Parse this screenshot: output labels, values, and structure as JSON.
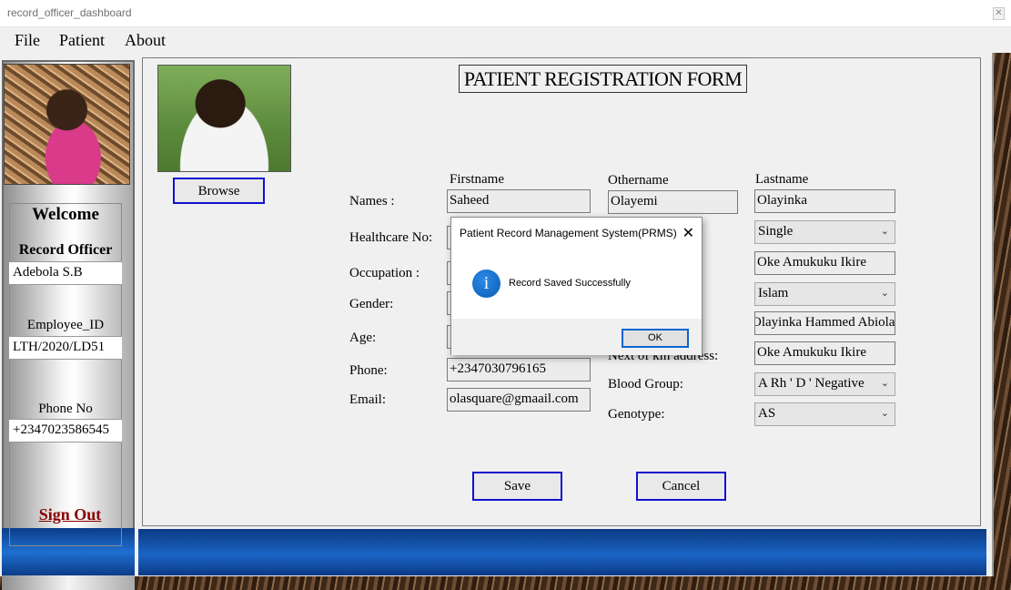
{
  "window": {
    "title": "record_officer_dashboard",
    "close_glyph": "✕"
  },
  "menu": [
    "File",
    "Patient",
    "About"
  ],
  "sidebar": {
    "welcome": "Welcome",
    "role": "Record Officer",
    "name": "Adebola S.B",
    "employee_id_label": "Employee_ID",
    "employee_id": "LTH/2020/LD51",
    "phone_label": "Phone No",
    "phone": "+2347023586545",
    "sign_out": "Sign Out"
  },
  "form": {
    "title": "PATIENT REGISTRATION FORM",
    "browse": "Browse",
    "columns": {
      "firstname": "Firstname",
      "othername": "Othername",
      "lastname": "Lastname"
    },
    "labels": {
      "names": "Names :",
      "healthcare_no": "Healthcare No:",
      "occupation": "Occupation :",
      "gender": "Gender:",
      "age": "Age:",
      "phone": "Phone:",
      "email": "Email:",
      "next_of_kin_address": "Next of kin address:",
      "blood_group": "Blood Group:",
      "genotype": "Genotype:"
    },
    "values": {
      "firstname": "Saheed",
      "othername": "Olayemi",
      "lastname": "Olayinka",
      "phone": "+2347030796165",
      "email": "olasquare@gmaail.com",
      "marital_status": "Single",
      "address": "Oke Amukuku Ikire",
      "religion": "Islam",
      "next_of_kin": "Olayinka Hammed Abiola",
      "next_of_kin_address": "Oke Amukuku Ikire",
      "blood_group": "A Rh ' D ' Negative",
      "genotype": "AS"
    },
    "save": "Save",
    "cancel": "Cancel"
  },
  "dialog": {
    "title": "Patient Record Management System(PRMS)",
    "message": "Record Saved Successfully",
    "ok": "OK",
    "close_glyph": "✕",
    "icon": "info-icon"
  }
}
